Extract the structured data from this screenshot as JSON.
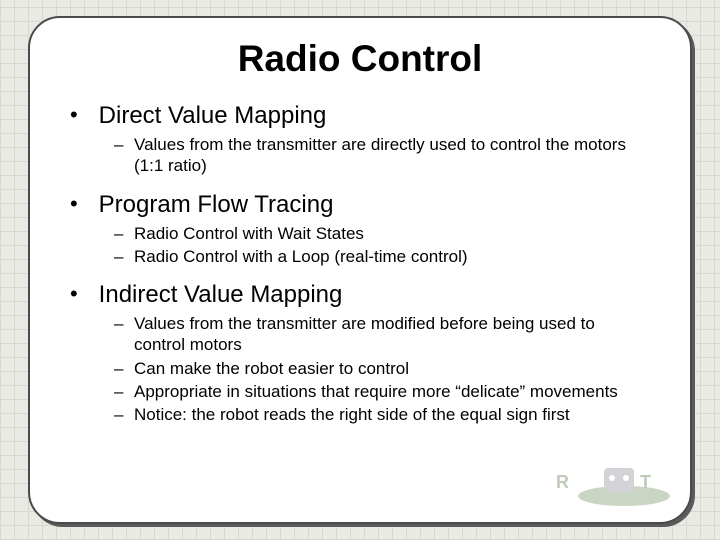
{
  "title": "Radio Control",
  "bullets": [
    {
      "label": "Direct Value Mapping",
      "subs": [
        "Values from the transmitter are directly used to control the motors (1:1 ratio)"
      ]
    },
    {
      "label": "Program Flow Tracing",
      "subs": [
        "Radio Control with Wait States",
        "Radio Control with a Loop (real-time control)"
      ]
    },
    {
      "label": "Indirect Value Mapping",
      "subs": [
        "Values from the transmitter are modified before being used to control motors",
        "Can make the robot easier to control",
        "Appropriate in situations that require more “delicate” movements",
        "Notice: the robot reads the right side of the equal sign first"
      ]
    }
  ]
}
